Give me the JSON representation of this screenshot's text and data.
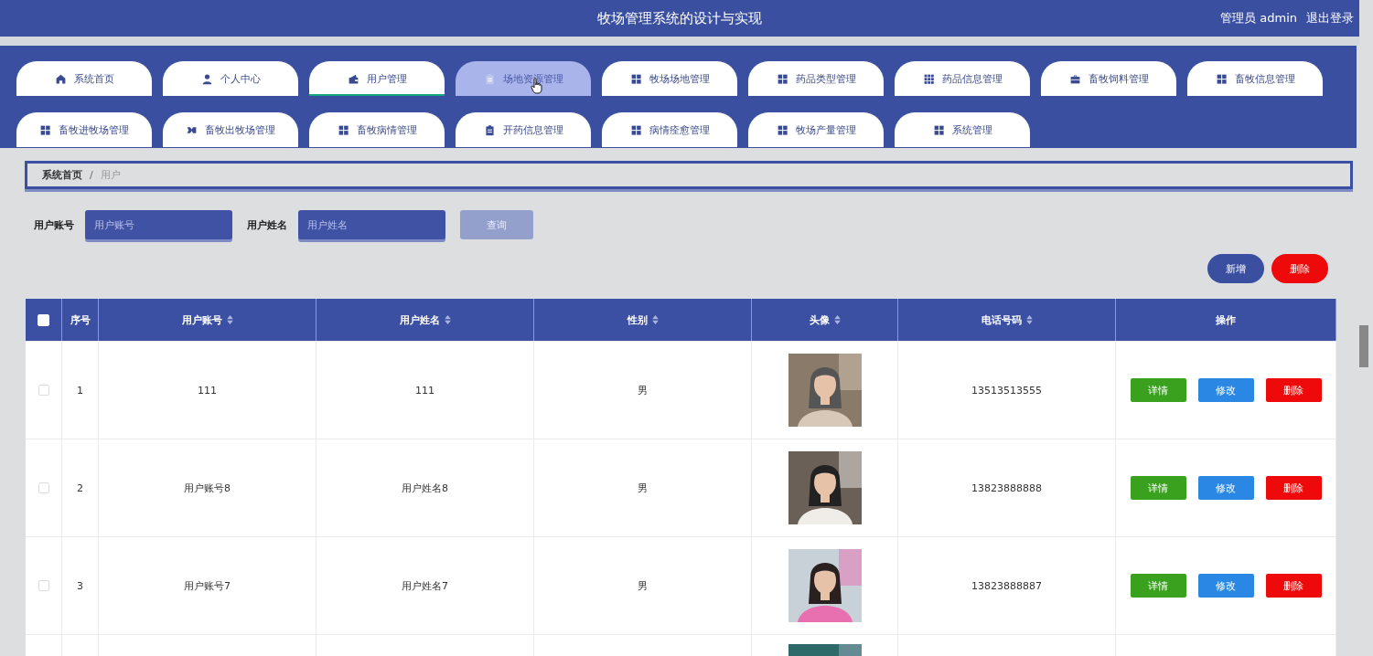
{
  "header": {
    "title": "牧场管理系统的设计与实现",
    "user": "管理员 admin",
    "logout": "退出登录"
  },
  "tabs": [
    {
      "label": "系统首页",
      "selected": false,
      "hovered": false
    },
    {
      "label": "个人中心",
      "selected": false,
      "hovered": false
    },
    {
      "label": "用户管理",
      "selected": true,
      "hovered": false
    },
    {
      "label": "场地资源管理",
      "selected": false,
      "hovered": true
    },
    {
      "label": "牧场场地管理",
      "selected": false,
      "hovered": false
    },
    {
      "label": "药品类型管理",
      "selected": false,
      "hovered": false
    },
    {
      "label": "药品信息管理",
      "selected": false,
      "hovered": false
    },
    {
      "label": "畜牧饲料管理",
      "selected": false,
      "hovered": false
    },
    {
      "label": "畜牧信息管理",
      "selected": false,
      "hovered": false
    },
    {
      "label": "畜牧进牧场管理",
      "selected": false,
      "hovered": false
    },
    {
      "label": "畜牧出牧场管理",
      "selected": false,
      "hovered": false
    },
    {
      "label": "畜牧病情管理",
      "selected": false,
      "hovered": false
    },
    {
      "label": "开药信息管理",
      "selected": false,
      "hovered": false
    },
    {
      "label": "病情痊愈管理",
      "selected": false,
      "hovered": false
    },
    {
      "label": "牧场产量管理",
      "selected": false,
      "hovered": false
    },
    {
      "label": "系统管理",
      "selected": false,
      "hovered": false
    }
  ],
  "breadcrumb": [
    "系统首页",
    "用户"
  ],
  "breadcrumb_separator": "/",
  "search": {
    "fields": [
      {
        "label": "用户账号",
        "placeholder": "用户账号"
      },
      {
        "label": "用户姓名",
        "placeholder": "用户姓名"
      }
    ],
    "button": "查询"
  },
  "actions": {
    "add": "新增",
    "delete": "删除"
  },
  "table": {
    "columns": [
      {
        "label": "序号",
        "sortable": false
      },
      {
        "label": "用户账号",
        "sortable": true
      },
      {
        "label": "用户姓名",
        "sortable": true
      },
      {
        "label": "性别",
        "sortable": true
      },
      {
        "label": "头像",
        "sortable": true
      },
      {
        "label": "电话号码",
        "sortable": true
      },
      {
        "label": "操作",
        "sortable": false
      }
    ],
    "header_checked": false,
    "rows": [
      {
        "checked": false,
        "index": "1",
        "account": "111",
        "name": "111",
        "gender": "男",
        "avatar": {
          "kind": "picture"
        },
        "phone": "13513513555",
        "actions": [
          "详情",
          "修改",
          "删除"
        ]
      },
      {
        "checked": false,
        "index": "2",
        "account": "用户账号8",
        "name": "用户姓名8",
        "gender": "男",
        "avatar": {
          "kind": "picture"
        },
        "phone": "13823888888",
        "actions": [
          "详情",
          "修改",
          "删除"
        ]
      },
      {
        "checked": false,
        "index": "3",
        "account": "用户账号7",
        "name": "用户姓名7",
        "gender": "男",
        "avatar": {
          "kind": "picture"
        },
        "phone": "13823888887",
        "actions": [
          "详情",
          "修改",
          "删除"
        ]
      },
      {
        "avatar": {
          "kind": "picture"
        }
      }
    ]
  }
}
